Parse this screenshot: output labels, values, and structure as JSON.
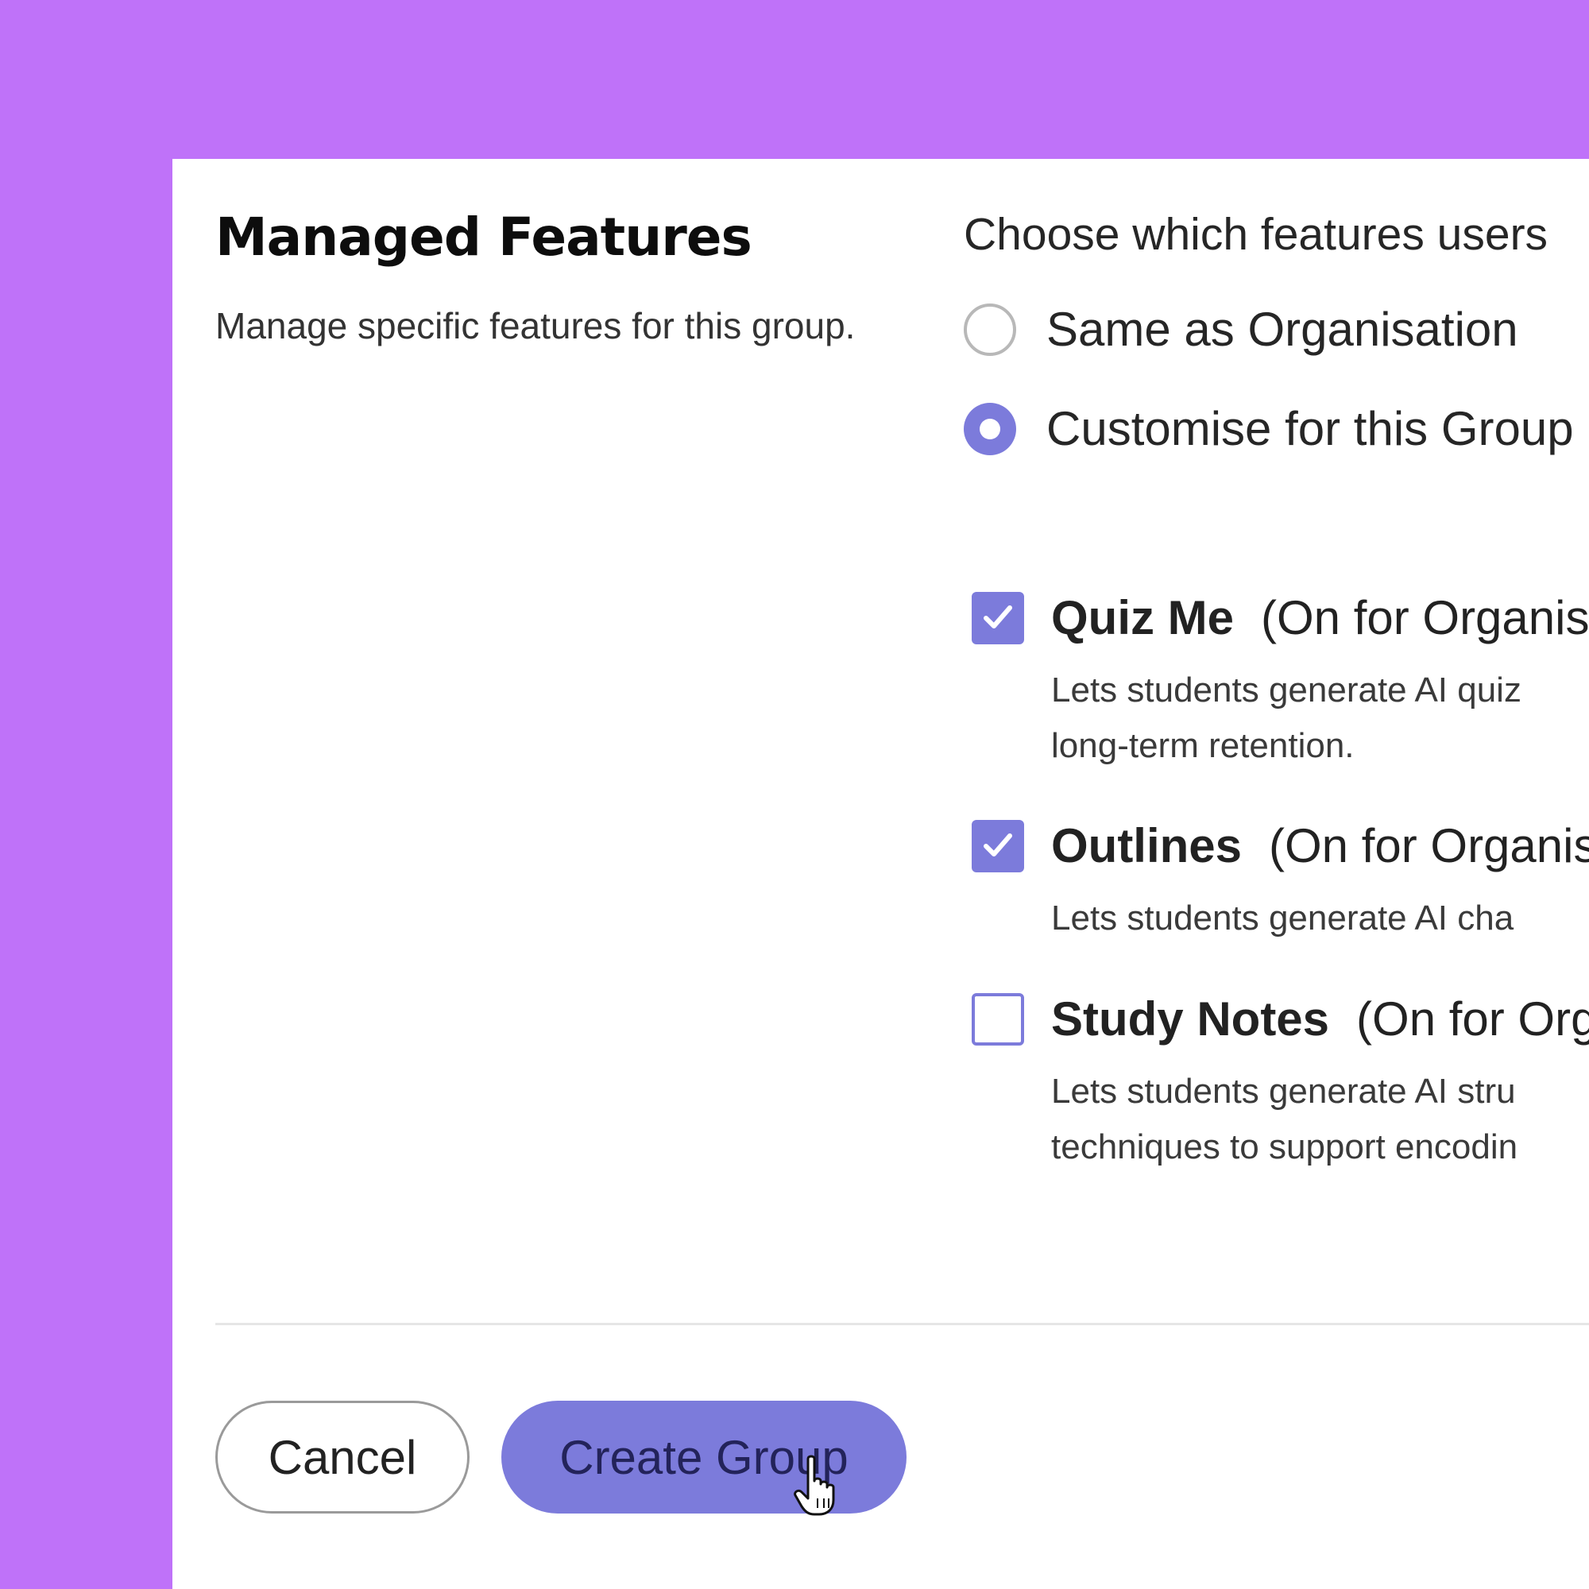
{
  "header": {
    "title": "Managed Features",
    "subtitle": "Manage specific features for this group."
  },
  "feature_mode": {
    "prompt": "Choose which features users",
    "options": [
      {
        "label": "Same as Organisation",
        "selected": false
      },
      {
        "label": "Customise for this Group",
        "selected": true
      }
    ]
  },
  "features": [
    {
      "name": "Quiz Me",
      "org_status": "(On for Organis",
      "checked": true,
      "description_lines": [
        "Lets students generate AI quiz",
        "long-term retention."
      ]
    },
    {
      "name": "Outlines",
      "org_status": "(On for Organis",
      "checked": true,
      "description_lines": [
        "Lets students generate AI cha"
      ]
    },
    {
      "name": "Study Notes",
      "org_status": "(On for Org",
      "checked": false,
      "description_lines": [
        "Lets students generate AI stru",
        "techniques to support encodin"
      ]
    }
  ],
  "footer": {
    "cancel_label": "Cancel",
    "create_label": "Create Group"
  },
  "colors": {
    "background": "#bf72f9",
    "accent": "#7c7bdb",
    "panel": "#ffffff"
  },
  "icons": {
    "checkmark": "check-icon",
    "cursor": "hand-pointer-icon"
  }
}
